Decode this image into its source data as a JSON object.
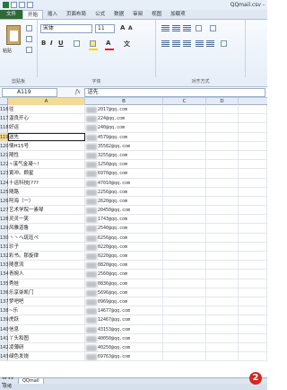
{
  "window": {
    "title": "QQmail.csv -"
  },
  "tabs": [
    "文件",
    "开始",
    "插入",
    "页面布局",
    "公式",
    "数据",
    "审阅",
    "视图",
    "加载项"
  ],
  "ribbon": {
    "paste_label": "粘贴",
    "font_name": "宋体",
    "font_size": "11",
    "groups": {
      "clipboard": "剪贴板",
      "font": "字体",
      "alignment": "对齐方式"
    }
  },
  "formula_bar": {
    "cell_ref": "A119",
    "fx": "fx",
    "value": "送先"
  },
  "columns": [
    "A",
    "B",
    "C",
    "D"
  ],
  "selected_row": "119",
  "rows": [
    {
      "num": "116",
      "name": "往",
      "email": "2017@qq.com"
    },
    {
      "num": "117",
      "name": "温良开心",
      "email": "224@qq.com"
    },
    {
      "num": "118",
      "name": "好运",
      "email": "240@qq.com"
    },
    {
      "num": "119",
      "name": "送先",
      "email": "4579@qq.com"
    },
    {
      "num": "120",
      "name": "情H15号",
      "email": "35582@qq.com"
    },
    {
      "num": "121",
      "name": "随性",
      "email": "3255@qq.com"
    },
    {
      "num": "122",
      "name": "~溪气金凝~!",
      "email": "1250@qq.com"
    },
    {
      "num": "123",
      "name": "寅冲。顾星",
      "email": "6970@qq.com"
    },
    {
      "num": "124",
      "name": "十运科技[???",
      "email": "47010@qq.com"
    },
    {
      "num": "125",
      "name": "随路",
      "email": "2256@qq.com"
    },
    {
      "num": "126",
      "name": "阿海（一）",
      "email": "2620@qq.com"
    },
    {
      "num": "127",
      "name": "艺术学院一素琴",
      "email": "20450@qq.com"
    },
    {
      "num": "128",
      "name": "灵灵一笑",
      "email": "1743@qq.com"
    },
    {
      "num": "129",
      "name": "风雅道鲁",
      "email": "2540@qq.com"
    },
    {
      "num": "130",
      "name": "ヽヽへ琉珏ぺ",
      "email": "6256@qq.com"
    },
    {
      "num": "131",
      "name": "珍子",
      "email": "0220@qq.com"
    },
    {
      "num": "132",
      "name": "彩书。那旋律",
      "email": "0220@qq.com"
    },
    {
      "num": "133",
      "name": "随意流",
      "email": "0820@qq.com"
    },
    {
      "num": "134",
      "name": "青婉人",
      "email": "2560@qq.com"
    },
    {
      "num": "135",
      "name": "秀娃",
      "email": "0836@qq.com"
    },
    {
      "num": "136",
      "name": "乐享柒凯门",
      "email": "5696@qq.com"
    },
    {
      "num": "137",
      "name": "梦吧吧",
      "email": "0969@qq.com"
    },
    {
      "num": "138",
      "name": "~乐",
      "email": "14677@qq.com"
    },
    {
      "num": "139",
      "name": "虎跃",
      "email": "12467@qq.com"
    },
    {
      "num": "140",
      "name": "信息",
      "email": "43153@qq.com"
    },
    {
      "num": "141",
      "name": "丫头和图",
      "email": "40050@qq.com"
    },
    {
      "num": "142",
      "name": "凌薄研",
      "email": "40250@qq.com"
    },
    {
      "num": "143",
      "name": "绿色发烧",
      "email": "69763@qq.com"
    }
  ],
  "sheet_tab": "QQmail",
  "status": "就绪",
  "badge": "2"
}
